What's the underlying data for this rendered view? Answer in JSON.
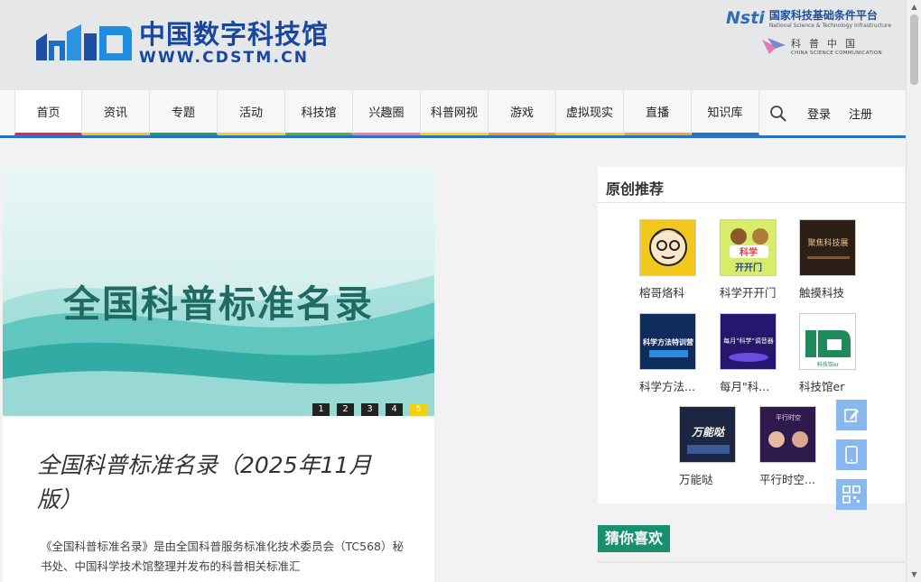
{
  "header": {
    "logo_cn": "中国数字科技馆",
    "logo_url": "WWW.CDSTM.CN",
    "nsti_mark": "Nsti",
    "nsti_cn": "国家科技基础条件平台",
    "nsti_en": "National Science & Technology Infrastructure",
    "csc_cn": "科普中国",
    "csc_en": "CHINA SCIENCE COMMUNICATION"
  },
  "nav": {
    "items": [
      {
        "label": "首页",
        "color": "#e8206c"
      },
      {
        "label": "资讯",
        "color": "#f6c21b"
      },
      {
        "label": "专题",
        "color": "#18a36a"
      },
      {
        "label": "活动",
        "color": "#f5d11a"
      },
      {
        "label": "科技馆",
        "color": "#5eaf36"
      },
      {
        "label": "兴趣圈",
        "color": "#f07bb2"
      },
      {
        "label": "科普网视",
        "color": "#ffd600"
      },
      {
        "label": "游戏",
        "color": "#f89a1d"
      },
      {
        "label": "虚拟现实",
        "color": "#f9d826"
      },
      {
        "label": "直播",
        "color": "#f5a623"
      },
      {
        "label": "知识库",
        "color": "#2a72c5"
      }
    ],
    "login": "登录",
    "register": "注册"
  },
  "banner": {
    "title": "全国科普标准名录",
    "pages": [
      "1",
      "2",
      "3",
      "4",
      "5"
    ],
    "active_page": 5
  },
  "article": {
    "title": "全国科普标准名录（2025年11月版）",
    "description": "《全国科普标准名录》是由全国科普服务标准化技术委员会（TC568）秘书处、中国科学技术馆整理并发布的科普相关标准汇"
  },
  "recommend": {
    "title": "原创推荐",
    "items": [
      {
        "label": "榕哥烙科",
        "thumb_text": ""
      },
      {
        "label": "科学开开门",
        "thumb_text": "科学开开门"
      },
      {
        "label": "触摸科技",
        "thumb_text": "聚焦科技展"
      },
      {
        "label": "科学方法...",
        "thumb_text": "科学方法特训营"
      },
      {
        "label": "每月\"科...",
        "thumb_text": "每月\"科学\"调音器"
      },
      {
        "label": "科技馆er",
        "thumb_text": "科技馆er"
      },
      {
        "label": "万能哒",
        "thumb_text": "万能哒"
      },
      {
        "label": "平行时空...",
        "thumb_text": "平行时空"
      }
    ]
  },
  "guess": {
    "title": "猜你喜欢"
  },
  "float_buttons": [
    "edit-icon",
    "mobile-icon",
    "qrcode-icon"
  ]
}
